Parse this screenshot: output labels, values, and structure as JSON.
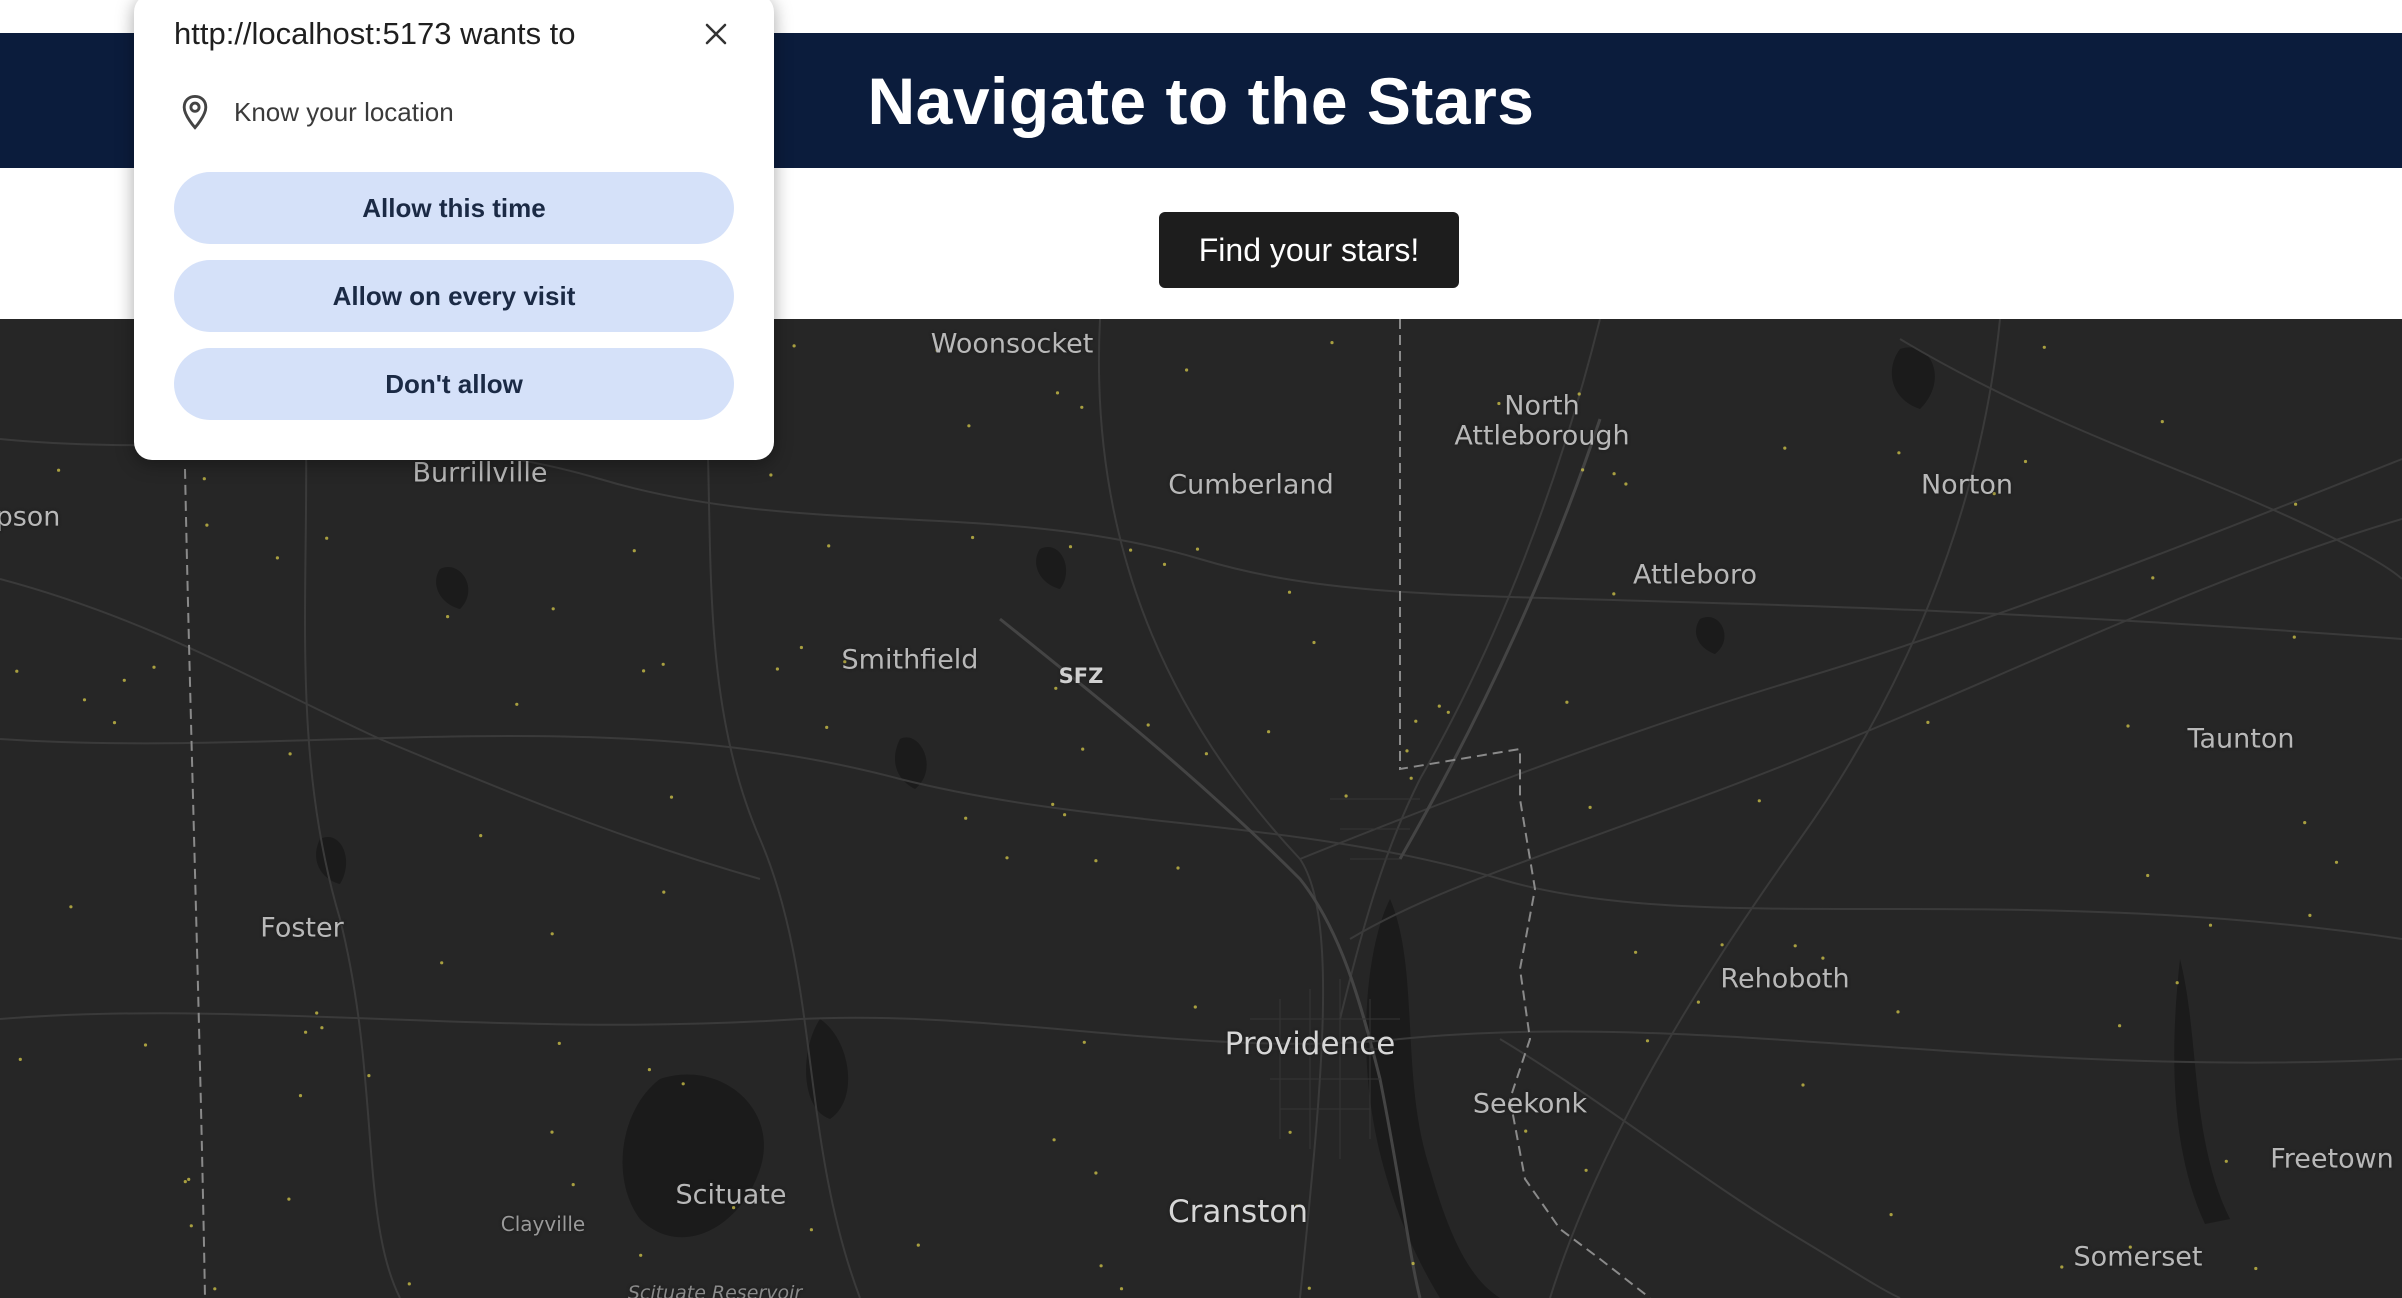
{
  "header": {
    "title": "Navigate to the Stars"
  },
  "toolbar": {
    "find_button_label": "Find your stars!"
  },
  "map": {
    "labels": {
      "woonsocket": "Woonsocket",
      "north_attleborough_1": "North",
      "north_attleborough_2": "Attleborough",
      "burrillville": "Burrillville",
      "thompson": "pson",
      "cumberland": "Cumberland",
      "norton": "Norton",
      "attleboro": "Attleboro",
      "smithfield": "Smithfield",
      "sfz": "SFZ",
      "taunton": "Taunton",
      "foster": "Foster",
      "rehoboth": "Rehoboth",
      "providence": "Providence",
      "seekonk": "Seekonk",
      "freetown": "Freetown",
      "scituate": "Scituate",
      "cranston": "Cranston",
      "clayville": "Clayville",
      "somerset": "Somerset",
      "scituate_reservoir": "Scituate Reservoir"
    },
    "star_color": "#d4c84a"
  },
  "permission_popup": {
    "title": "http://localhost:5173 wants to",
    "permission_text": "Know your location",
    "allow_once_label": "Allow this time",
    "allow_always_label": "Allow on every visit",
    "deny_label": "Don't allow"
  },
  "colors": {
    "header_bg": "#0b1c3c",
    "button_bg": "#1d1d1d",
    "map_bg": "#262626",
    "popup_button_bg": "#d5e1f9"
  }
}
